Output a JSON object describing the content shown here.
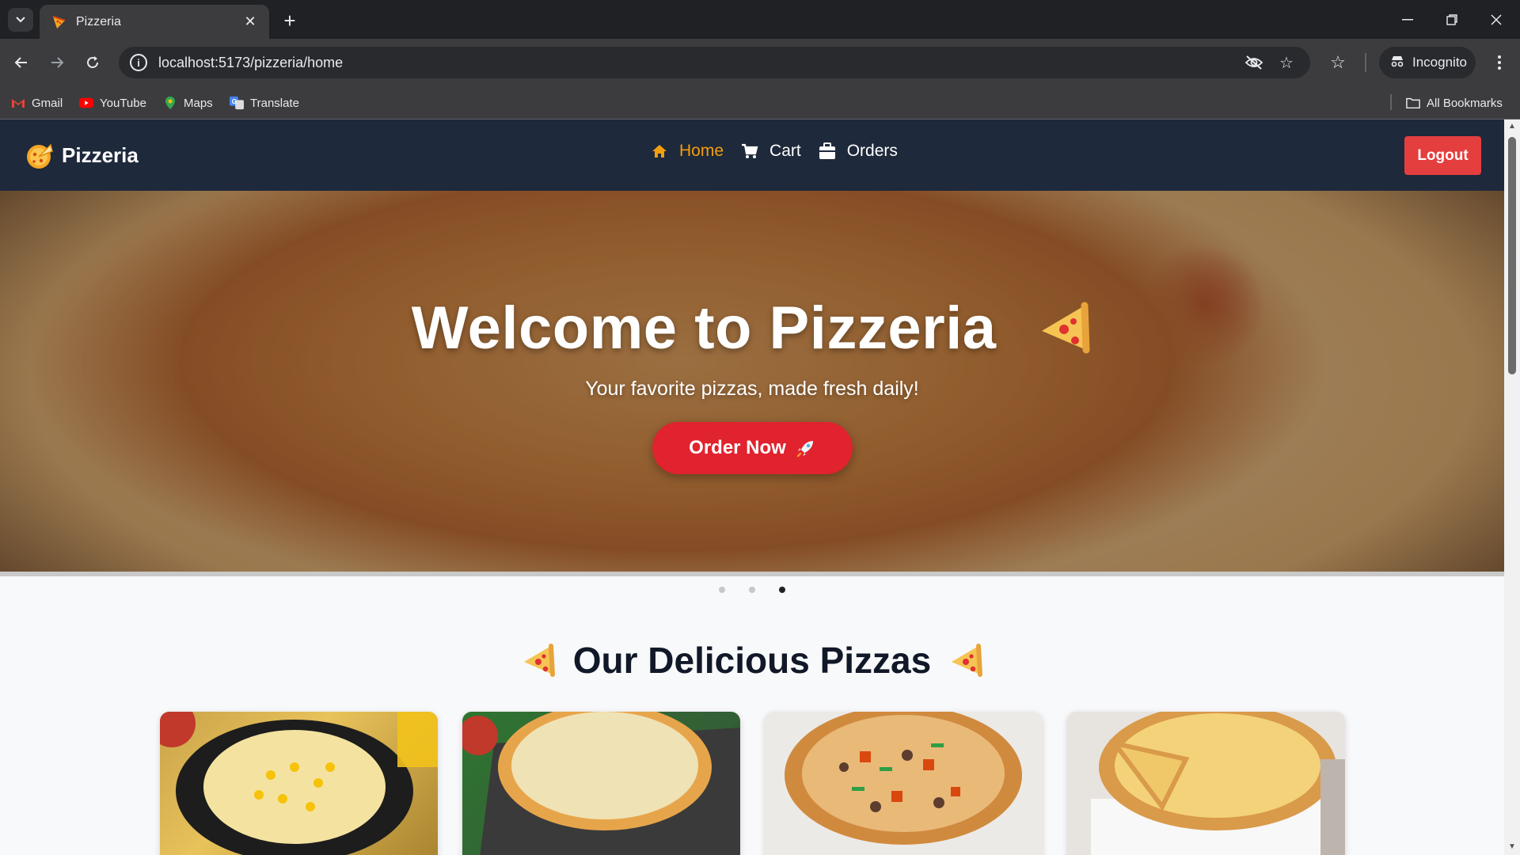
{
  "browser": {
    "tab_title": "Pizzeria",
    "url": "localhost:5173/pizzeria/home",
    "incognito_label": "Incognito",
    "bookmarks": [
      {
        "label": "Gmail",
        "icon": "gmail-icon"
      },
      {
        "label": "YouTube",
        "icon": "youtube-icon"
      },
      {
        "label": "Maps",
        "icon": "maps-icon"
      },
      {
        "label": "Translate",
        "icon": "translate-icon"
      }
    ],
    "all_bookmarks_label": "All Bookmarks"
  },
  "site": {
    "brand_name": "Pizzeria",
    "nav": [
      {
        "label": "Home",
        "icon": "home-icon",
        "active": true
      },
      {
        "label": "Cart",
        "icon": "cart-icon",
        "active": false
      },
      {
        "label": "Orders",
        "icon": "orders-icon",
        "active": false
      }
    ],
    "logout_label": "Logout"
  },
  "hero": {
    "title": "Welcome to Pizzeria",
    "subtitle": "Your favorite pizzas, made fresh daily!",
    "cta_label": "Order Now",
    "slide_count": 3,
    "active_slide": 3
  },
  "section": {
    "title": "Our Delicious Pizzas"
  },
  "colors": {
    "nav_bg": "#1e293b",
    "accent": "#f59e0b",
    "danger": "#e53e3e",
    "cta": "#e0232e"
  }
}
